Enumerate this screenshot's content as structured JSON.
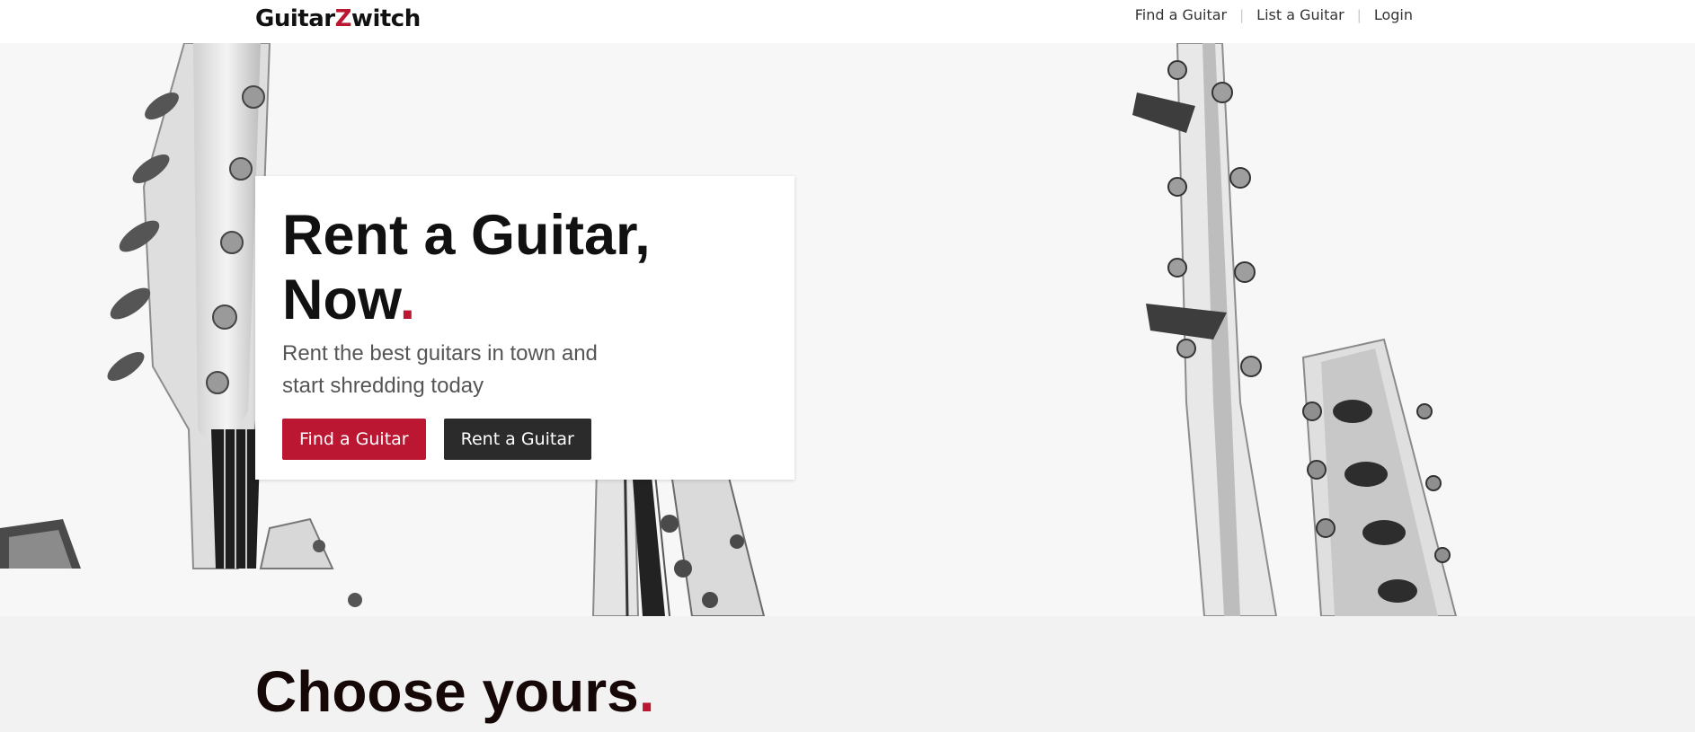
{
  "header": {
    "logo_left": "Guitar",
    "logo_mark": "Z",
    "logo_right": "witch",
    "nav": [
      {
        "label": "Find a Guitar"
      },
      {
        "label": "List a Guitar"
      },
      {
        "label": "Login"
      }
    ],
    "separator": "|"
  },
  "hero": {
    "title_line1": "Rent a Guitar,",
    "title_line2": "Now",
    "title_dot": ".",
    "subtitle": "Rent the best guitars in town and start shredding today",
    "primary_button": "Find a Guitar",
    "secondary_button": "Rent a Guitar",
    "background": "black-and-white guitar headstocks photo"
  },
  "section": {
    "title": "Choose yours",
    "title_dot": "."
  },
  "colors": {
    "accent": "#bb1733",
    "dark_button": "#2b2b2b",
    "header_bg": "#ffffff",
    "section_bg": "#f2f2f2"
  }
}
